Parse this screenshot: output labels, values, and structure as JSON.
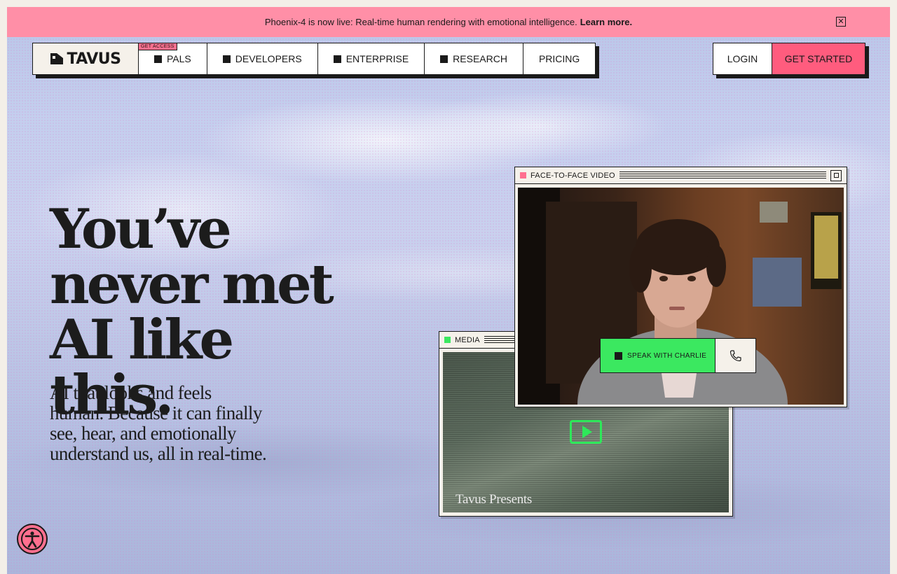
{
  "announcement": {
    "text": "Phoenix-4 is now live: Real-time human rendering with emotional intelligence.",
    "link": "Learn more.",
    "close_icon": "close-icon"
  },
  "nav": {
    "logo": "TAVUS",
    "items": [
      {
        "label": "PALS",
        "badge": "GET ACCESS",
        "icon": "square-icon"
      },
      {
        "label": "DEVELOPERS",
        "icon": "square-icon"
      },
      {
        "label": "ENTERPRISE",
        "icon": "square-icon"
      },
      {
        "label": "RESEARCH",
        "icon": "square-icon"
      },
      {
        "label": "PRICING"
      }
    ]
  },
  "auth": {
    "login": "LOGIN",
    "get_started": "GET STARTED"
  },
  "hero": {
    "title_line1": "You’ve",
    "title_line2": "never met",
    "title_line3": "AI like this.",
    "subtitle": "AI that looks and feels human. Because it can finally see, hear, and emotionally understand us, all in real-time."
  },
  "media_window": {
    "title": "MEDIA",
    "caption": "Tavus Presents",
    "accent": "#3be860"
  },
  "video_window": {
    "title": "FACE-TO-FACE VIDEO",
    "speak_button": "SPEAK WITH CHARLIE",
    "accent": "#ff6f8f"
  },
  "colors": {
    "banner": "#ff8fa7",
    "primary_cta": "#ff5c7e",
    "green": "#3be860",
    "ink": "#1a1a1a"
  }
}
